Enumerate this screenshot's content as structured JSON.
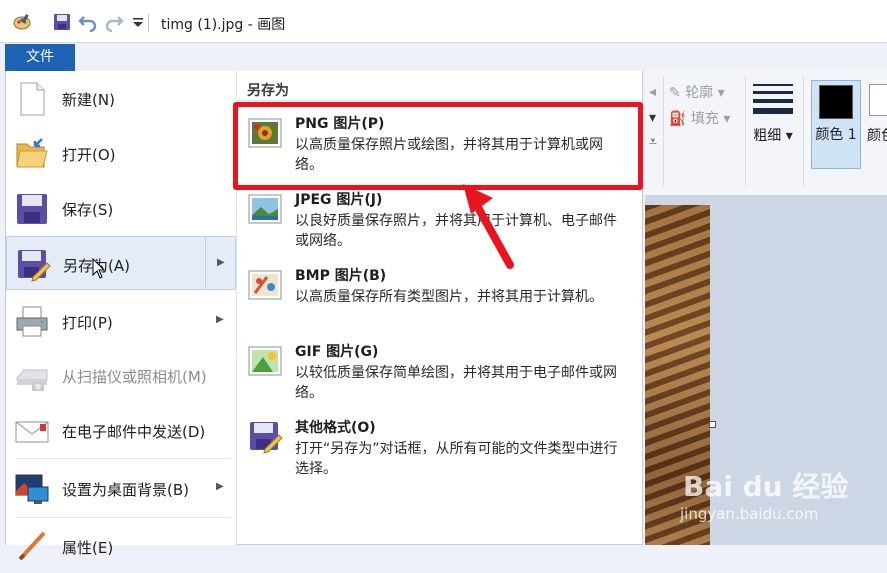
{
  "window": {
    "title": "timg (1).jpg - 画图"
  },
  "file_tab": {
    "label": "文件"
  },
  "menu": {
    "items": [
      {
        "label": "新建(N)",
        "icon": "new-document-icon",
        "has_submenu": false,
        "enabled": true
      },
      {
        "label": "打开(O)",
        "icon": "open-folder-icon",
        "has_submenu": false,
        "enabled": true
      },
      {
        "label": "保存(S)",
        "icon": "save-disk-icon",
        "has_submenu": false,
        "enabled": true
      },
      {
        "label": "另存为(A)",
        "icon": "save-as-icon",
        "has_submenu": true,
        "enabled": true,
        "active": true
      },
      {
        "label": "打印(P)",
        "icon": "printer-icon",
        "has_submenu": true,
        "enabled": true
      },
      {
        "label": "从扫描仪或照相机(M)",
        "icon": "scanner-icon",
        "has_submenu": false,
        "enabled": false
      },
      {
        "label": "在电子邮件中发送(D)",
        "icon": "email-icon",
        "has_submenu": false,
        "enabled": true
      },
      {
        "label": "设置为桌面背景(B)",
        "icon": "desktop-background-icon",
        "has_submenu": true,
        "enabled": true
      },
      {
        "label": "属性(E)",
        "icon": "properties-icon",
        "has_submenu": false,
        "enabled": true
      }
    ]
  },
  "save_as": {
    "heading": "另存为",
    "formats": [
      {
        "name": "PNG 图片(P)",
        "desc": "以高质量保存照片或绘图，并将其用于计算机或网络。",
        "icon": "png-image-icon"
      },
      {
        "name": "JPEG 图片(J)",
        "desc": "以良好质量保存照片，并将其用于计算机、电子邮件或网络。",
        "icon": "jpeg-image-icon"
      },
      {
        "name": "BMP 图片(B)",
        "desc": "以高质量保存所有类型图片，并将其用于计算机。",
        "icon": "bmp-image-icon"
      },
      {
        "name": "GIF 图片(G)",
        "desc": "以较低质量保存简单绘图，并将其用于电子邮件或网络。",
        "icon": "gif-image-icon"
      },
      {
        "name": "其他格式(O)",
        "desc": "打开“另存为”对话框，从所有可能的文件类型中进行选择。",
        "icon": "other-formats-icon"
      }
    ]
  },
  "ribbon": {
    "outline_label": "轮廓",
    "fill_label": "填充",
    "thickness_label": "粗细",
    "color1_label": "颜色 1",
    "color2_label": "颜色",
    "color1_value": "#000000"
  },
  "watermark": {
    "brand": "Bai du 经验",
    "url": "jingyan.baidu.com"
  },
  "colors": {
    "accent": "#1e62b4",
    "highlight": "#e8141f"
  }
}
